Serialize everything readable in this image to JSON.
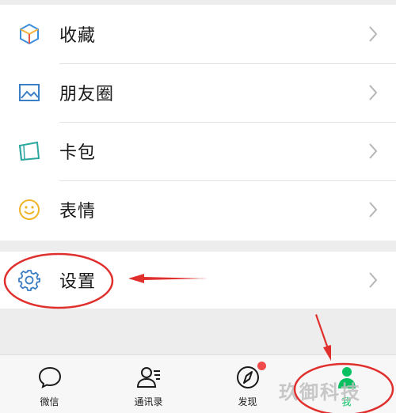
{
  "menu": {
    "items": [
      {
        "label": "收藏",
        "icon": "favorites-cube-icon"
      },
      {
        "label": "朋友圈",
        "icon": "moments-image-icon"
      },
      {
        "label": "卡包",
        "icon": "card-wallet-icon"
      },
      {
        "label": "表情",
        "icon": "sticker-smiley-icon"
      }
    ],
    "settings": {
      "label": "设置",
      "icon": "gear-icon"
    }
  },
  "tabbar": {
    "tabs": [
      {
        "label": "微信",
        "icon": "chat-bubble-icon"
      },
      {
        "label": "通讯录",
        "icon": "contacts-icon"
      },
      {
        "label": "发现",
        "icon": "compass-icon"
      },
      {
        "label": "我",
        "icon": "me-person-icon"
      }
    ]
  },
  "watermark": "玖御科技",
  "colors": {
    "accent_green": "#07c160",
    "badge_red": "#f04a4a",
    "annotation_red": "#e0302e",
    "cube_yellow": "#f3b43c",
    "cube_blue": "#3d8fdc",
    "cube_red": "#e8594a"
  }
}
